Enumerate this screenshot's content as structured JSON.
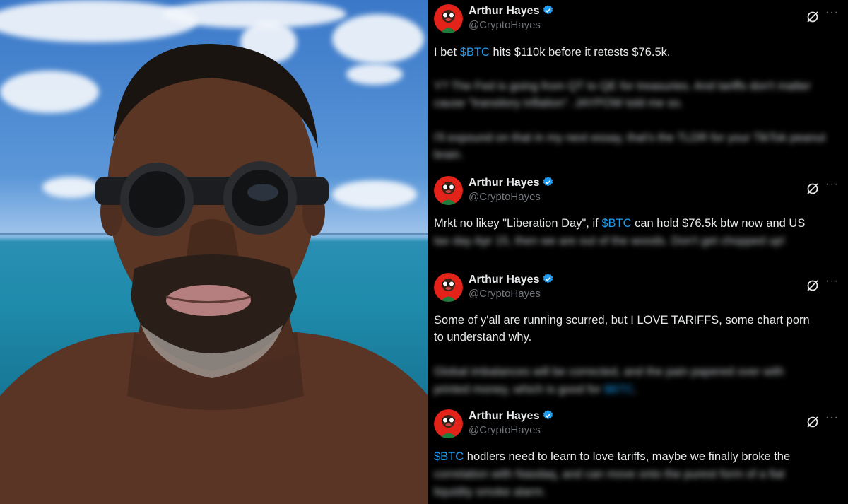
{
  "photo": {
    "alt_subject": "selfie-photo"
  },
  "tweets": [
    {
      "name": "Arthur Hayes",
      "handle": "@CryptoHayes",
      "line1_pre": "I bet ",
      "line1_tag": "$BTC",
      "line1_post": " hits $110k before it retests $76.5k.",
      "blur1": "Y? The Fed is going from QT to QE for treasuries. And tariffs don't matter cause \"transitory inflation\". JAYPOW told me so.",
      "blur2": "I'll expound on that in my next essay, that's the TLDR for your TikTok peanut brain."
    },
    {
      "name": "Arthur Hayes",
      "handle": "@CryptoHayes",
      "line1_pre": "Mrkt no likey \"Liberation Day\", if ",
      "line1_tag": "$BTC",
      "line1_post": " can hold $76.5k btw now and US",
      "blur1": "tax day Apr 15, then we are out of the woods. Don't get chopped up!"
    },
    {
      "name": "Arthur Hayes",
      "handle": "@CryptoHayes",
      "line1": "Some of y'all are running scurred, but I LOVE TARIFFS, some chart porn",
      "line2": "to understand why.",
      "blur1": "Global imbalances will be corrected, and the pain papered over with",
      "blur2_pre": "printed money, which is good for ",
      "blur2_tag": "$BTC",
      "blur2_post": "."
    },
    {
      "name": "Arthur Hayes",
      "handle": "@CryptoHayes",
      "line1_tag": "$BTC",
      "line1_post": " hodlers need to learn to love tariffs, maybe we finally broke the",
      "blur1": "correlation with Nasdaq, and can move onto the purest form of a fiat",
      "blur2": "liquidity smoke alarm."
    }
  ],
  "icons": {
    "verified": "verified-badge-icon",
    "grok": "grok-icon",
    "more": "more-options-icon"
  },
  "colors": {
    "accent": "#1d9bf0",
    "text": "#e7e9ea",
    "muted": "#71767b",
    "background": "#000000"
  },
  "more_glyph": "···"
}
